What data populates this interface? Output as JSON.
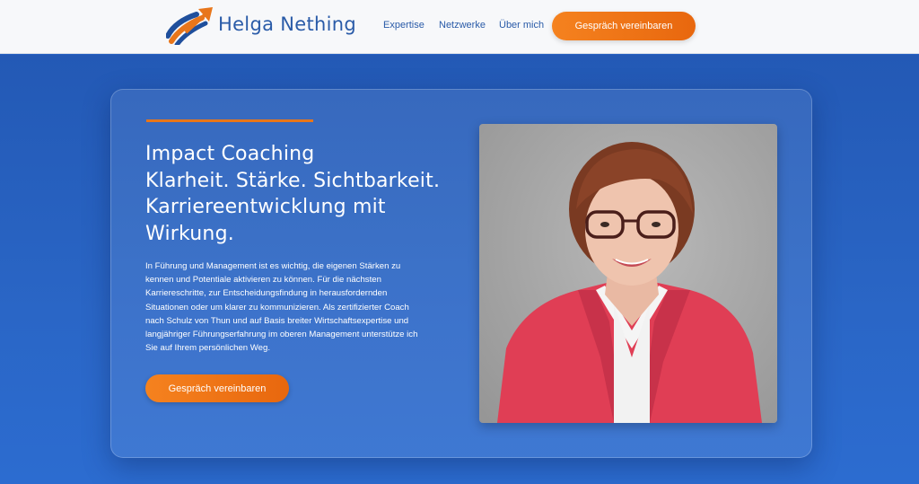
{
  "header": {
    "brand": "Helga Nething",
    "logo_icon": "rising-arrow-logo-icon",
    "nav": [
      "Expertise",
      "Netzwerke",
      "Über mich"
    ],
    "cta_label": "Gespräch vereinbaren"
  },
  "hero": {
    "headline": [
      "Impact Coaching",
      "Klarheit. Stärke. Sichtbarkeit.",
      "Karriereentwicklung mit",
      "Wirkung."
    ],
    "body": [
      "In Führung und Management ist es wichtig, die eigenen Stärken zu",
      "kennen und Potentiale aktivieren zu können. Für die nächsten",
      "Karriereschritte, zur Entscheidungsfindung in herausfordernden",
      "Situationen oder um klarer zu kommunizieren. Als zertifizierter Coach",
      "nach Schulz von Thun und auf Basis breiter Wirtschaftsexpertise und",
      "langjähriger Führungserfahrung im oberen Management unterstütze ich",
      "Sie auf Ihrem persönlichen Weg."
    ],
    "cta_label": "Gespräch vereinbaren",
    "photo": "portrait-photo"
  },
  "colors": {
    "accent": "#e8761b",
    "primary": "#2a5ba8",
    "background": "#2a64c4"
  }
}
